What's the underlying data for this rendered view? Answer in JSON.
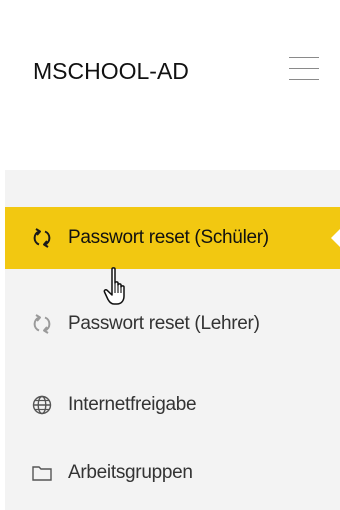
{
  "header": {
    "title": "MSCHOOL-AD",
    "menu_icon": "hamburger-menu-icon"
  },
  "sidebar": {
    "items": [
      {
        "label": "Passwort reset (Schüler)",
        "icon": "refresh-icon",
        "active": true
      },
      {
        "label": "Passwort reset (Lehrer)",
        "icon": "refresh-icon",
        "active": false
      },
      {
        "label": "Internetfreigabe",
        "icon": "globe-icon",
        "active": false
      },
      {
        "label": "Arbeitsgruppen",
        "icon": "folder-icon",
        "active": false
      }
    ]
  },
  "colors": {
    "accent": "#f2c811",
    "sidebar_bg": "#f3f3f3",
    "text": "#333333"
  }
}
